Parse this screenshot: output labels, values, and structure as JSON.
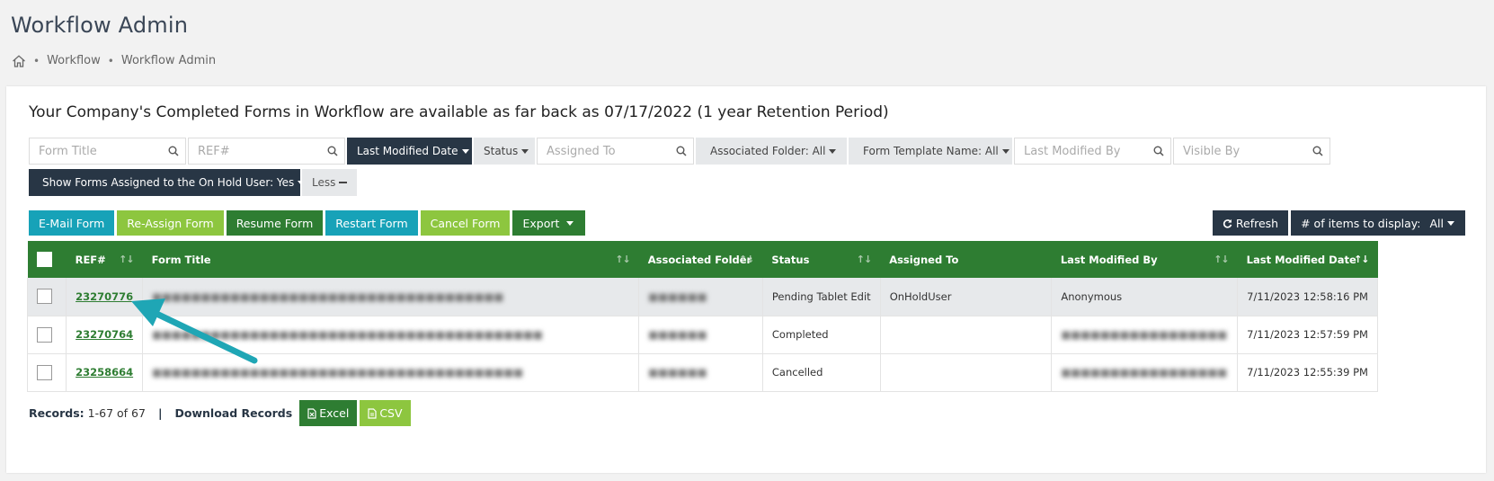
{
  "page_title": "Workflow Admin",
  "breadcrumb": {
    "home_icon": "home-icon",
    "items": [
      "Workflow",
      "Workflow Admin"
    ],
    "separator": "•"
  },
  "notice": "Your Company's Completed Forms in Workflow are available as far back as 07/17/2022 (1 year Retention Period)",
  "filters": {
    "form_title_placeholder": "Form Title",
    "ref_placeholder": "REF#",
    "last_modified_date": "Last Modified Date",
    "status": "Status",
    "assigned_to_placeholder": "Assigned To",
    "associated_folder": "Associated Folder: All",
    "form_template_name": "Form Template Name: All",
    "last_modified_by_placeholder": "Last Modified By",
    "visible_by_placeholder": "Visible By",
    "show_on_hold": "Show Forms Assigned to the On Hold User: Yes",
    "less": "Less"
  },
  "actions": {
    "email_form": "E-Mail Form",
    "reassign_form": "Re-Assign Form",
    "resume_form": "Resume Form",
    "restart_form": "Restart Form",
    "cancel_form": "Cancel Form",
    "export": "Export",
    "refresh": "Refresh",
    "items_to_display_label": "# of items to display:",
    "items_to_display_value": "All"
  },
  "table": {
    "columns": [
      "REF#",
      "Form Title",
      "Associated Folder",
      "Status",
      "Assigned To",
      "Last Modified By",
      "Last Modified Date"
    ],
    "rows": [
      {
        "ref": "23270776",
        "form_title": "",
        "folder": "",
        "status": "Pending Tablet Edit",
        "assigned_to": "OnHoldUser",
        "modified_by": "Anonymous",
        "modified_date": "7/11/2023 12:58:16 PM",
        "highlighted": true
      },
      {
        "ref": "23270764",
        "form_title": "",
        "folder": "",
        "status": "Completed",
        "assigned_to": "",
        "modified_by": "",
        "modified_date": "7/11/2023 12:57:59 PM",
        "highlighted": false
      },
      {
        "ref": "23258664",
        "form_title": "",
        "folder": "",
        "status": "Cancelled",
        "assigned_to": "",
        "modified_by": "",
        "modified_date": "7/11/2023 12:55:39 PM",
        "highlighted": false
      }
    ]
  },
  "footer": {
    "records_label": "Records:",
    "records_value": "1-67 of 67",
    "pipe": "|",
    "download_label": "Download Records",
    "excel": "Excel",
    "csv": "CSV"
  },
  "colors": {
    "green": "#2e7d32",
    "lime": "#8dc63f",
    "teal": "#17a2b8",
    "dark": "#283645",
    "annotation_arrow": "#1fa6b5"
  }
}
